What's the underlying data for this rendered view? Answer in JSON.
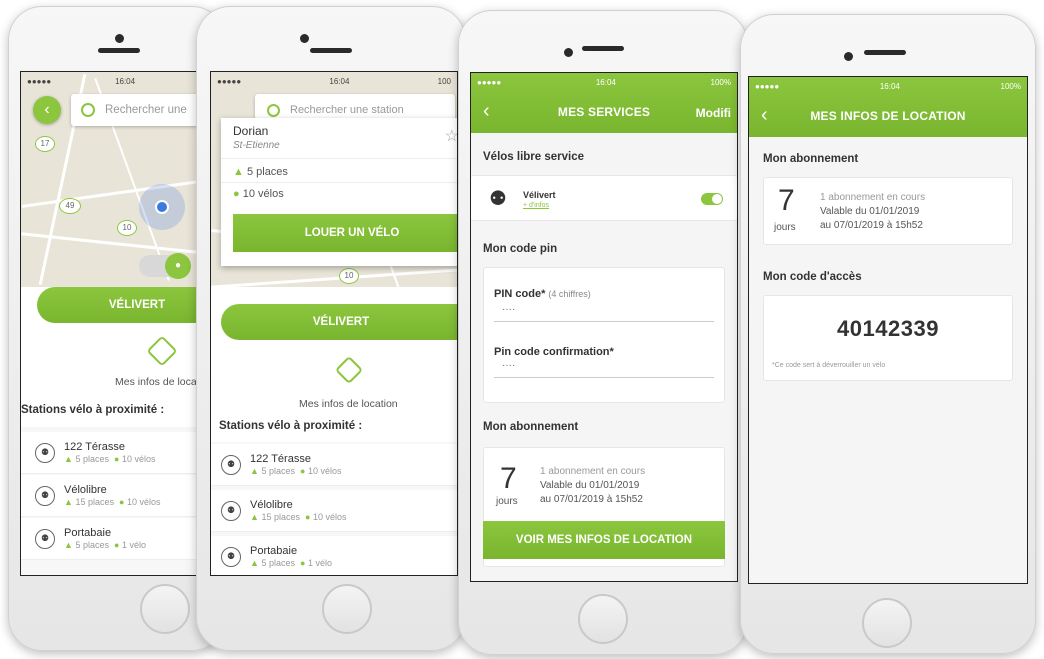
{
  "colors": {
    "accent": "#8cc63f",
    "accent_dark": "#79b52e",
    "text": "#333333"
  },
  "phone1": {
    "status_time": "16:04",
    "search_placeholder": "Rechercher une",
    "map_markers": [
      "17",
      "49",
      "10"
    ],
    "main_button": "VÉLIVERT",
    "rental_info_label": "Mes infos de locat",
    "nearby_title": "Stations vélo à proximité :",
    "stations": [
      {
        "name": "122 Térasse",
        "places": "5 places",
        "bikes": "10 vélos"
      },
      {
        "name": "Vélolibre",
        "places": "15 places",
        "bikes": "10 vélos"
      },
      {
        "name": "Portabaie",
        "places": "5 places",
        "bikes": "1 vélo"
      }
    ]
  },
  "phone2": {
    "status_time": "16:04",
    "status_battery": "100",
    "search_placeholder": "Rechercher une station",
    "popup": {
      "name": "Dorian",
      "city": "St-Etienne",
      "places": "5 places",
      "bikes": "10 vélos",
      "button": "LOUER UN VÉLO"
    },
    "map_marker": "10",
    "main_button": "VÉLIVERT",
    "rental_info_label": "Mes infos de location",
    "nearby_title": "Stations vélo à proximité :",
    "stations": [
      {
        "name": "122 Térasse",
        "places": "5 places",
        "bikes": "10 vélos"
      },
      {
        "name": "Vélolibre",
        "places": "15 places",
        "bikes": "10 vélos"
      },
      {
        "name": "Portabaie",
        "places": "5 places",
        "bikes": "1 vélo"
      }
    ]
  },
  "phone3": {
    "status_time": "16:04",
    "status_battery": "100%",
    "title": "MES SERVICES",
    "edit": "Modifi",
    "free_bikes_title": "Vélos libre service",
    "service": {
      "name": "Vélivert",
      "more": "+ d'infos",
      "enabled": true
    },
    "pin_title": "Mon code pin",
    "pin_label": "PIN code",
    "pin_hint": "(4 chiffres)",
    "pin_value": "····",
    "pin_confirm_label": "Pin code confirmation",
    "pin_confirm_value": "····",
    "sub_title": "Mon abonnement",
    "sub": {
      "days": "7",
      "unit": "jours",
      "line1": "1 abonnement en cours",
      "line2": "Valable du 01/01/2019",
      "line3": "au 07/01/2019 à 15h52"
    },
    "button": "VOIR MES INFOS DE LOCATION"
  },
  "phone4": {
    "status_time": "16:04",
    "status_battery": "100%",
    "title": "MES INFOS DE LOCATION",
    "sub_title": "Mon abonnement",
    "sub": {
      "days": "7",
      "unit": "jours",
      "line1": "1 abonnement en cours",
      "line2": "Valable du 01/01/2019",
      "line3": "au 07/01/2019 à 15h52"
    },
    "access_title": "Mon code d'accès",
    "code": "40142339",
    "note": "*Ce code sert à déverrouiller un vélo"
  }
}
